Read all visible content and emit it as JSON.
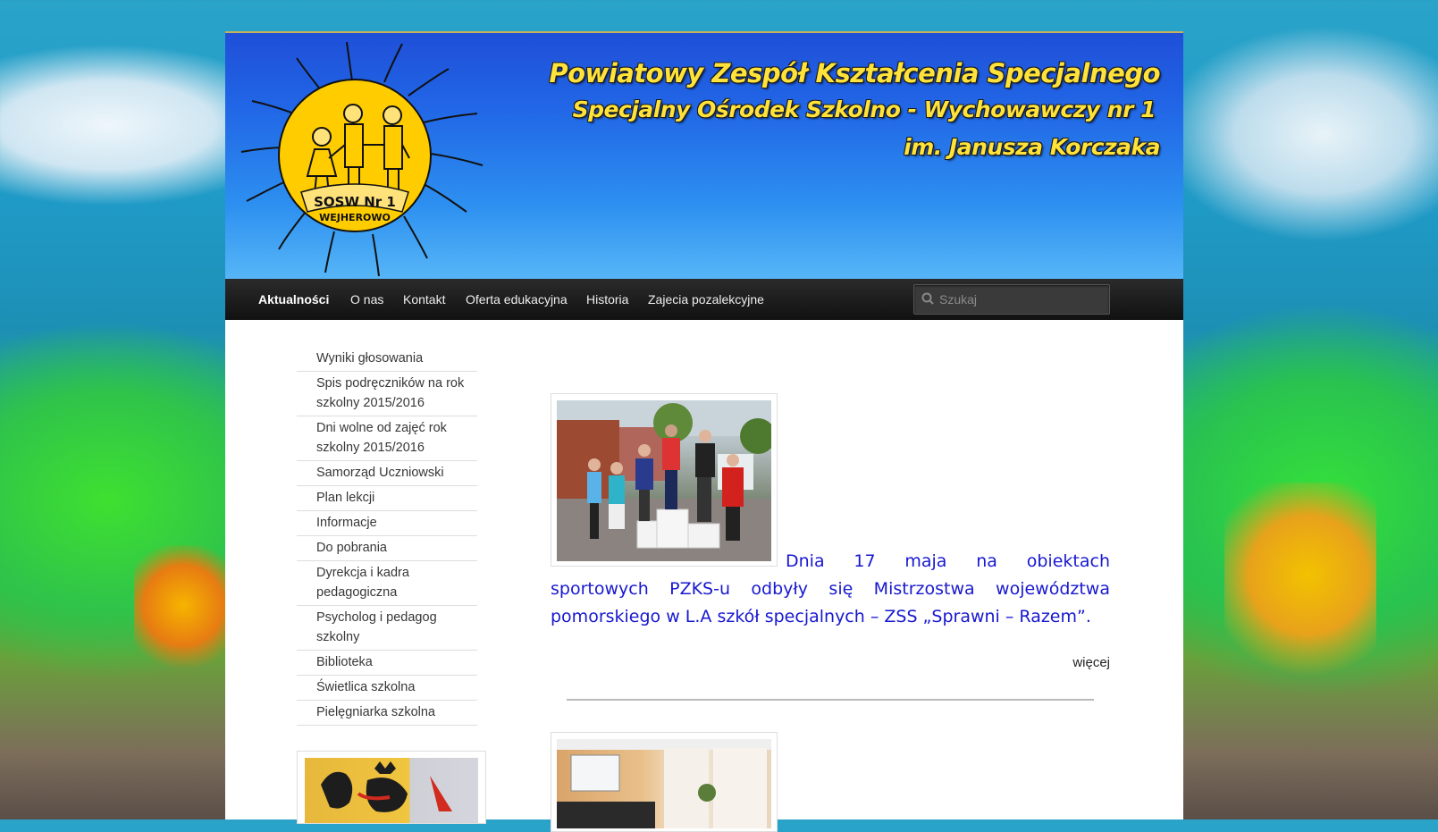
{
  "header": {
    "title_line1": "Powiatowy Zespół Kształcenia Specjalnego",
    "title_line2": "Specjalny Ośrodek Szkolno - Wychowawczy nr 1",
    "title_line3": "im. Janusza Korczaka",
    "logo_text_line1": "SOSW Nr 1",
    "logo_text_line2": "WEJHEROWO"
  },
  "nav": {
    "items": [
      {
        "label": "Aktualności",
        "active": true
      },
      {
        "label": "O nas",
        "active": false
      },
      {
        "label": "Kontakt",
        "active": false
      },
      {
        "label": "Oferta edukacyjna",
        "active": false
      },
      {
        "label": "Historia",
        "active": false
      },
      {
        "label": "Zajecia pozalekcyjne",
        "active": false
      }
    ],
    "search_placeholder": "Szukaj"
  },
  "sidebar": {
    "items": [
      {
        "label": "Wyniki głosowania"
      },
      {
        "label": "Spis podręczników na rok szkolny 2015/2016"
      },
      {
        "label": "Dni wolne od zajęć rok szkolny 2015/2016"
      },
      {
        "label": "Samorząd Uczniowski"
      },
      {
        "label": "Plan lekcji"
      },
      {
        "label": "Informacje"
      },
      {
        "label": "Do pobrania"
      },
      {
        "label": "Dyrekcja i kadra pedagogiczna"
      },
      {
        "label": "Psycholog i pedagog szkolny"
      },
      {
        "label": "Biblioteka"
      },
      {
        "label": "Świetlica szkolna"
      },
      {
        "label": "Pielęgniarka szkolna"
      }
    ]
  },
  "post": {
    "text": "Dnia 17 maja na obiektach sportowych PZKS-u odbyły się Mistrzostwa województwa pomorskiego w L.A szkół specjalnych – ZSS „Sprawni – Razem”.",
    "more_label": "więcej"
  },
  "colors": {
    "post_text": "#1818d0",
    "title_yellow": "#ffe23a",
    "nav_bg": "#1b1b1b"
  }
}
